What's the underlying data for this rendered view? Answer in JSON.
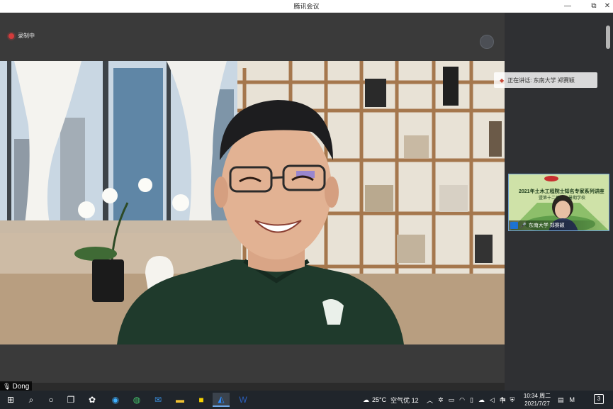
{
  "window": {
    "title": "腾讯会议",
    "minimize": "—",
    "maximize": "⧉",
    "close": "✕"
  },
  "stage": {
    "recording_label": "录制中"
  },
  "panel": {
    "speaking_label": "正在讲话: 东南大学 郑赛颖",
    "thumbnail": {
      "slide_line1": "2021年土木工程院士知名专家系列讲座",
      "slide_line2": "暨第十二届……暑期学校",
      "participant_name": "东南大学 郑赛颖"
    }
  },
  "active_speaker_tag": {
    "name": "Dong"
  },
  "taskbar": {
    "weather_temp": "25°C",
    "air_quality": "空气优 12",
    "ime": "中",
    "time": "10:34 周二",
    "date": "2021/7/27",
    "notification_count": "3"
  },
  "colors": {
    "recording_dot": "#d23b3b",
    "taskbar_bg": "#20252b",
    "accent": "#1f6fd1"
  }
}
